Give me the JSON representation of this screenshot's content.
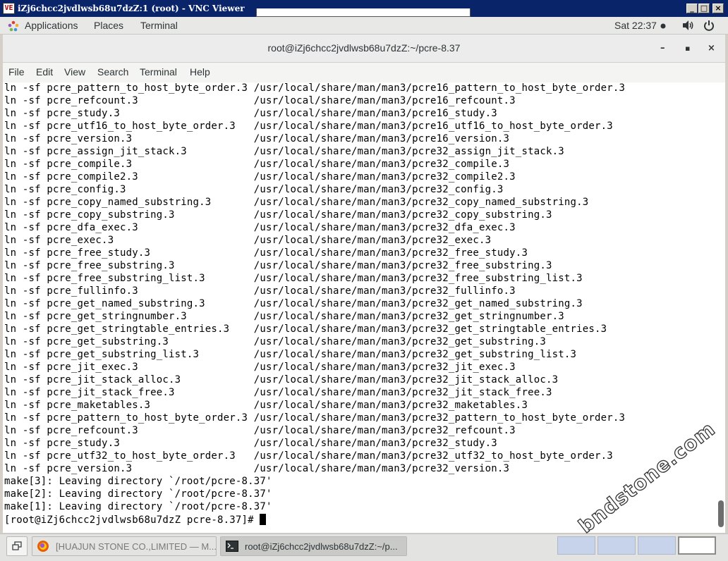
{
  "vnc": {
    "title": "iZj6chcc2jvdlwsb68u7dzZ:1 (root) - VNC Viewer",
    "logo": "VE",
    "minimize": "_",
    "maximize": "□",
    "close": "×"
  },
  "topbar": {
    "applications": "Applications",
    "places": "Places",
    "terminal": "Terminal",
    "clock": "Sat 22:37",
    "icons": [
      "applications-icon",
      "recording-dot-icon",
      "volume-icon",
      "power-icon"
    ]
  },
  "window": {
    "title": "root@iZj6chcc2jvdlwsb68u7dzZ:~/pcre-8.37",
    "minimize": "–",
    "maximize": "▪",
    "close": "×"
  },
  "menu": [
    "File",
    "Edit",
    "View",
    "Search",
    "Terminal",
    "Help"
  ],
  "terminal_lines": [
    "ln -sf pcre_pattern_to_host_byte_order.3 /usr/local/share/man/man3/pcre16_pattern_to_host_byte_order.3",
    "ln -sf pcre_refcount.3                   /usr/local/share/man/man3/pcre16_refcount.3",
    "ln -sf pcre_study.3                      /usr/local/share/man/man3/pcre16_study.3",
    "ln -sf pcre_utf16_to_host_byte_order.3   /usr/local/share/man/man3/pcre16_utf16_to_host_byte_order.3",
    "ln -sf pcre_version.3                    /usr/local/share/man/man3/pcre16_version.3",
    "ln -sf pcre_assign_jit_stack.3           /usr/local/share/man/man3/pcre32_assign_jit_stack.3",
    "ln -sf pcre_compile.3                    /usr/local/share/man/man3/pcre32_compile.3",
    "ln -sf pcre_compile2.3                   /usr/local/share/man/man3/pcre32_compile2.3",
    "ln -sf pcre_config.3                     /usr/local/share/man/man3/pcre32_config.3",
    "ln -sf pcre_copy_named_substring.3       /usr/local/share/man/man3/pcre32_copy_named_substring.3",
    "ln -sf pcre_copy_substring.3             /usr/local/share/man/man3/pcre32_copy_substring.3",
    "ln -sf pcre_dfa_exec.3                   /usr/local/share/man/man3/pcre32_dfa_exec.3",
    "ln -sf pcre_exec.3                       /usr/local/share/man/man3/pcre32_exec.3",
    "ln -sf pcre_free_study.3                 /usr/local/share/man/man3/pcre32_free_study.3",
    "ln -sf pcre_free_substring.3             /usr/local/share/man/man3/pcre32_free_substring.3",
    "ln -sf pcre_free_substring_list.3        /usr/local/share/man/man3/pcre32_free_substring_list.3",
    "ln -sf pcre_fullinfo.3                   /usr/local/share/man/man3/pcre32_fullinfo.3",
    "ln -sf pcre_get_named_substring.3        /usr/local/share/man/man3/pcre32_get_named_substring.3",
    "ln -sf pcre_get_stringnumber.3           /usr/local/share/man/man3/pcre32_get_stringnumber.3",
    "ln -sf pcre_get_stringtable_entries.3    /usr/local/share/man/man3/pcre32_get_stringtable_entries.3",
    "ln -sf pcre_get_substring.3              /usr/local/share/man/man3/pcre32_get_substring.3",
    "ln -sf pcre_get_substring_list.3         /usr/local/share/man/man3/pcre32_get_substring_list.3",
    "ln -sf pcre_jit_exec.3                   /usr/local/share/man/man3/pcre32_jit_exec.3",
    "ln -sf pcre_jit_stack_alloc.3            /usr/local/share/man/man3/pcre32_jit_stack_alloc.3",
    "ln -sf pcre_jit_stack_free.3             /usr/local/share/man/man3/pcre32_jit_stack_free.3",
    "ln -sf pcre_maketables.3                 /usr/local/share/man/man3/pcre32_maketables.3",
    "ln -sf pcre_pattern_to_host_byte_order.3 /usr/local/share/man/man3/pcre32_pattern_to_host_byte_order.3",
    "ln -sf pcre_refcount.3                   /usr/local/share/man/man3/pcre32_refcount.3",
    "ln -sf pcre_study.3                      /usr/local/share/man/man3/pcre32_study.3",
    "ln -sf pcre_utf32_to_host_byte_order.3   /usr/local/share/man/man3/pcre32_utf32_to_host_byte_order.3",
    "ln -sf pcre_version.3                    /usr/local/share/man/man3/pcre32_version.3",
    "make[3]: Leaving directory `/root/pcre-8.37'",
    "make[2]: Leaving directory `/root/pcre-8.37'",
    "make[1]: Leaving directory `/root/pcre-8.37'"
  ],
  "prompt": "[root@iZj6chcc2jvdlwsb68u7dzZ pcre-8.37]# ",
  "watermark": "bndstone.com",
  "taskbar": {
    "show_desktop_icon": "show-desktop-icon",
    "tasks": [
      {
        "label": "[HUAJUN STONE CO.,LIMITED — M...",
        "icon": "firefox-icon",
        "active": false
      },
      {
        "label": "root@iZj6chcc2jvdlwsb68u7dzZ:~/p...",
        "icon": "terminal-icon",
        "active": true
      }
    ],
    "workspaces": 4,
    "active_workspace": 4
  },
  "colors": {
    "vnc_titlebar": "#0a246a",
    "terminal_bg": "#ffffff",
    "terminal_fg": "#000000",
    "workspace_inactive": "#c7d3ea"
  }
}
